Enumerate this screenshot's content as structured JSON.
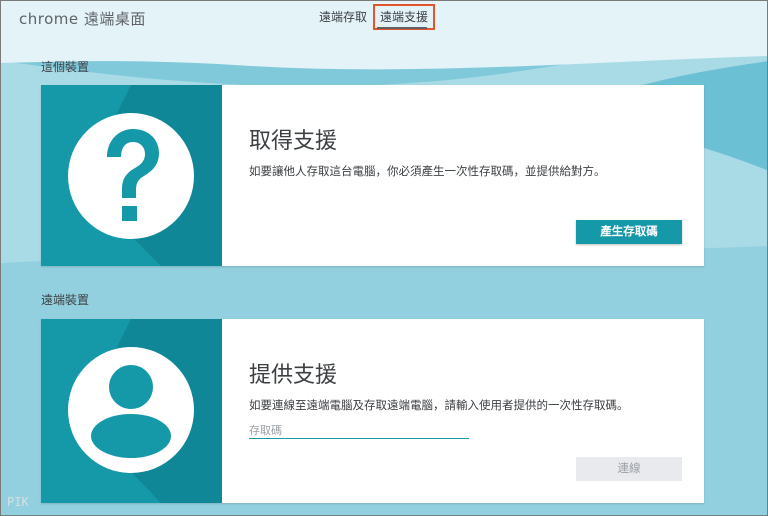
{
  "app": {
    "title": "chrome 遠端桌面"
  },
  "tabs": [
    {
      "label": "遠端存取"
    },
    {
      "label": "遠端支援"
    }
  ],
  "sections": {
    "this_device": "這個裝置",
    "remote_devices": "遠端裝置"
  },
  "get_support": {
    "title": "取得支援",
    "description": "如要讓他人存取這台電腦，你必須產生一次性存取碼，並提供給對方。",
    "button_label": "產生存取碼",
    "icon": "question-mark-icon"
  },
  "give_support": {
    "title": "提供支援",
    "description": "如要連線至遠端電腦及存取遠端電腦，請輸入使用者提供的一次性存取碼。",
    "input_placeholder": "存取碼",
    "input_value": "",
    "button_label": "連線",
    "icon": "person-icon"
  },
  "watermark": "PIK",
  "colors": {
    "accent": "#1598a8",
    "highlight_border": "#e2542a",
    "background": "#9fd6e3"
  }
}
